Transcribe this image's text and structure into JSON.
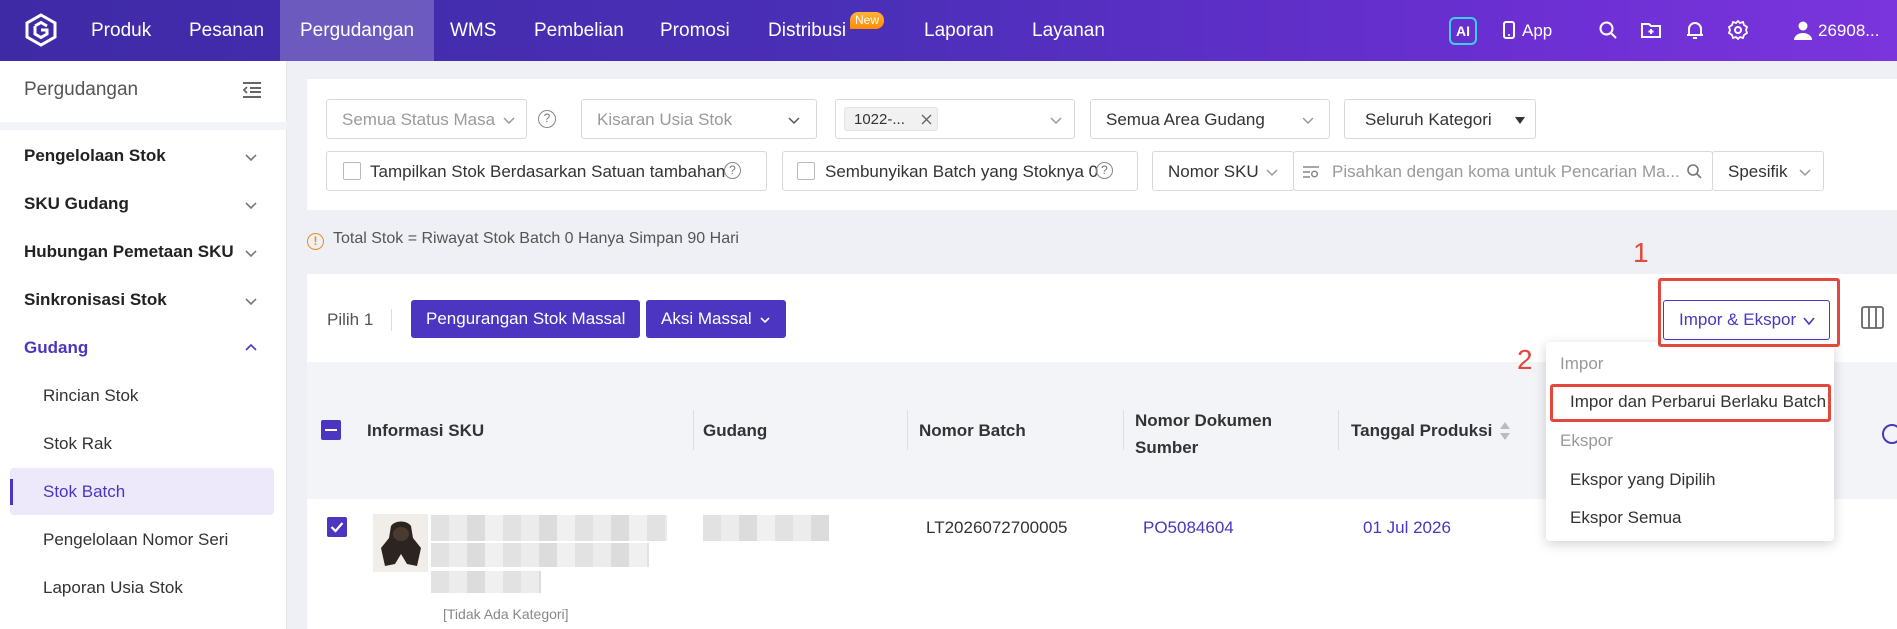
{
  "topnav": {
    "items": [
      "Produk",
      "Pesanan",
      "Pergudangan",
      "WMS",
      "Pembelian",
      "Promosi",
      "Distribusi",
      "Laporan",
      "Layanan"
    ],
    "new_badge": "New",
    "ai": "AI",
    "app": "App",
    "user": "26908..."
  },
  "sidebar": {
    "title": "Pergudangan",
    "groups": [
      "Pengelolaan Stok",
      "SKU Gudang",
      "Hubungan Pemetaan SKU",
      "Sinkronisasi Stok",
      "Gudang"
    ],
    "subitems": [
      "Rincian Stok",
      "Stok Rak",
      "Stok Batch",
      "Pengelolaan Nomor Seri",
      "Laporan Usia Stok"
    ]
  },
  "filters": {
    "batch_status_placeholder": "Semua Status Masa",
    "stock_age_placeholder": "Kisaran Usia Stok",
    "warehouse_tag": "1022-...",
    "area": "Semua Area Gudang",
    "category": "Seluruh Kategori",
    "show_by_unit": "Tampilkan Stok Berdasarkan Satuan tambahan",
    "hide_zero": "Sembunyikan Batch yang Stoknya 0",
    "sku_type": "Nomor SKU",
    "search_placeholder": "Pisahkan dengan koma untuk Pencarian Ma...",
    "match_mode": "Spesifik"
  },
  "notice": "Total Stok = Riwayat Stok Batch 0 Hanya Simpan 90 Hari",
  "toolbar": {
    "selected": "Pilih 1",
    "bulk_reduce": "Pengurangan Stok Massal",
    "bulk_action": "Aksi Massal",
    "import_export": "Impor & Ekspor"
  },
  "table": {
    "headers": [
      "Informasi SKU",
      "Gudang",
      "Nomor Batch",
      "Nomor Dokumen Sumber",
      "Tanggal Produksi"
    ],
    "rows": [
      {
        "batch": "LT2026072700005",
        "source_doc": "PO5084604",
        "prod_date": "01 Jul 2026",
        "category": "[Tidak Ada Kategori]"
      }
    ]
  },
  "menu": {
    "import_group": "Impor",
    "import_batch": "Impor dan Perbarui Berlaku Batch",
    "export_group": "Ekspor",
    "export_selected": "Ekspor yang Dipilih",
    "export_all": "Ekspor Semua"
  },
  "annotations": {
    "step1": "1",
    "step2": "2"
  },
  "colors": {
    "accent": "#4c35c0",
    "highlight": "#e4473c"
  }
}
